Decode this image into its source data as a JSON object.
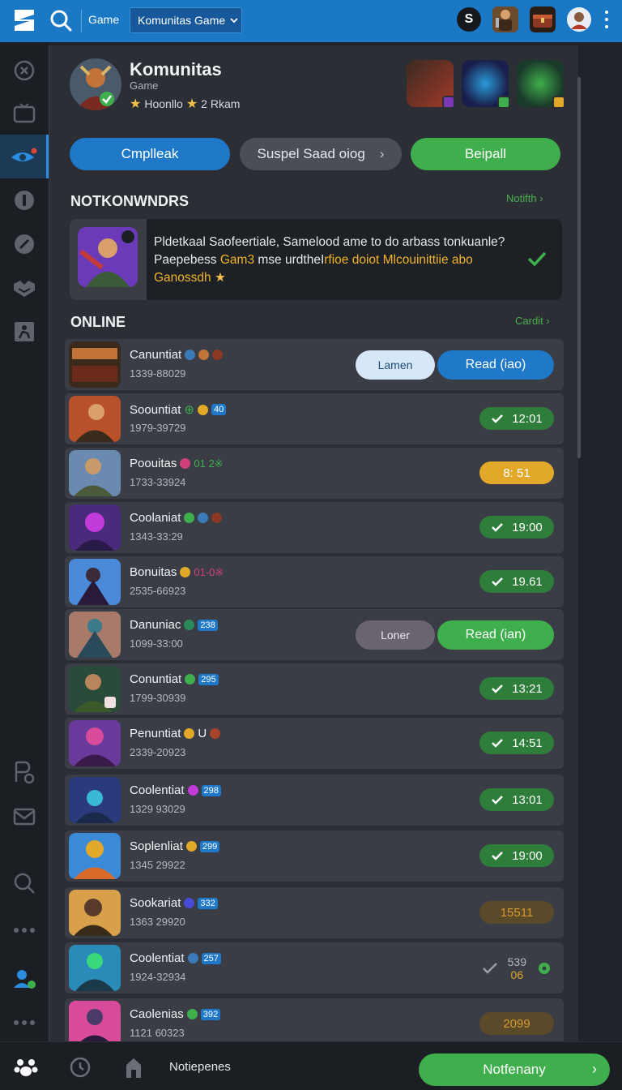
{
  "topbar": {
    "game_label": "Game",
    "dropdown_value": "Komunitas Game",
    "chip_label": "S"
  },
  "header": {
    "title": "Komunitas",
    "subtitle": "Game",
    "stat_1": "Hoonllo",
    "stat_2": "2 Rkam"
  },
  "actions": {
    "primary": "Cmplleak",
    "secondary": "Suspel Saad oiog",
    "tertiary": "Beipall"
  },
  "notifications": {
    "title": "NOTKONWNDRS",
    "link": "Notifth",
    "message_line1": "Pldetkaal Saofeertiale, Samelood ame to do arbass tonkuanle?",
    "message_line2_a": "Paepebess ",
    "message_line2_b": "Gam3",
    "message_line2_c": " mse urdtheI",
    "message_line2_d": "rfioe doiot Mlcouinittiie abo",
    "message_line3": "Ganossdh"
  },
  "online": {
    "title": "ONLINE",
    "link": "Cardit",
    "rows": [
      {
        "name": "Canuntiat",
        "badge": "",
        "id": "1339-88029",
        "lower": "Lamen",
        "read": "Read (iao)"
      },
      {
        "name": "Soountiat",
        "badge": "40",
        "id": "1979-39729",
        "time": "12:01"
      },
      {
        "name": "Poouitas",
        "badge": "01 2※",
        "id": "1733-33924",
        "time": "8: 51"
      },
      {
        "name": "Coolaniat",
        "badge": "",
        "id": "1343-33:29",
        "time": "19:00"
      },
      {
        "name": "Bonuitas",
        "badge": "01-0※",
        "id": "2535-66923",
        "time": "19.61"
      },
      {
        "name": "Danuniac",
        "badge": "238",
        "id": "1099-33:00",
        "lower": "Loner",
        "read": "Read (ian)"
      },
      {
        "name": "Conuntiat",
        "badge": "295",
        "id": "1799-30939",
        "time": "13:21"
      },
      {
        "name": "Penuntiat",
        "badge": "U",
        "id": "2339-20923",
        "time": "14:51"
      },
      {
        "name": "Coolentiat",
        "badge": "298",
        "id": "1329 93029",
        "time": "13:01"
      },
      {
        "name": "Soplenliat",
        "badge": "299",
        "id": "1345 29922",
        "time": "19:00"
      },
      {
        "name": "Sookariat",
        "badge": "332",
        "id": "1363 29920",
        "time": "15511"
      },
      {
        "name": "Coolentiat",
        "badge": "257",
        "id": "1924-32934",
        "time_a": "539",
        "time_b": "06"
      },
      {
        "name": "Caolenias",
        "badge": "392",
        "id": "1121 60323",
        "time": "2099"
      }
    ]
  },
  "bottombar": {
    "label": "Notiepenes",
    "button": "Notfenany"
  },
  "colors": {
    "brand_blue": "#1b78c4",
    "accent_green": "#3fae4c",
    "accent_amber": "#e2a82a",
    "panel": "#2b2e35"
  }
}
